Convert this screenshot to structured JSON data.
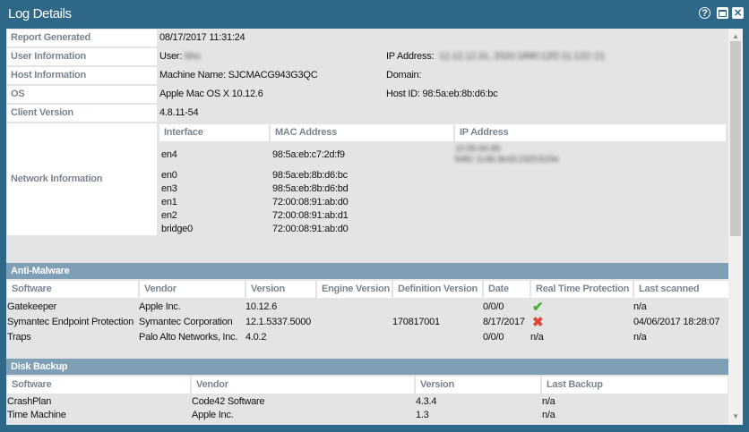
{
  "window": {
    "title": "Log Details",
    "help_icon": "help-icon",
    "maximize_icon": "maximize-icon",
    "close_icon": "close-icon"
  },
  "summary": {
    "report_generated": {
      "label": "Report Generated",
      "value": "08/17/2017 11:31:24"
    },
    "user_information": {
      "label": "User Information",
      "user_label": "User:",
      "user_value": "bhu",
      "ip_label": "IP Address:",
      "ip_value": "12.12.12.31, 2020:1890:12f2:11:122::21"
    },
    "host_information": {
      "label": "Host Information",
      "machine": "Machine Name: SJCMACG943G3QC",
      "domain": "Domain:"
    },
    "os": {
      "label": "OS",
      "value": "Apple Mac OS X 10.12.6",
      "host_id": "Host ID: 98:5a:eb:8b:d6:bc"
    },
    "client_version": {
      "label": "Client Version",
      "value": "4.8.11-54"
    }
  },
  "network": {
    "label": "Network Information",
    "columns": [
      "Interface",
      "MAC Address",
      "IP Address"
    ],
    "rows": [
      {
        "interface": "en4",
        "mac": "98:5a:eb:c7:2d:f9",
        "ip": [
          "10.55.84.89",
          "fe80::1c4b:3e43:2320:b15e"
        ]
      },
      {
        "interface": "en0",
        "mac": "98:5a:eb:8b:d6:bc",
        "ip": []
      },
      {
        "interface": "en3",
        "mac": "98:5a:eb:8b:d6:bd",
        "ip": []
      },
      {
        "interface": "en1",
        "mac": "72:00:08:91:ab:d0",
        "ip": []
      },
      {
        "interface": "en2",
        "mac": "72:00:08:91:ab:d1",
        "ip": []
      },
      {
        "interface": "bridge0",
        "mac": "72:00:08:91:ab:d0",
        "ip": []
      }
    ]
  },
  "anti_malware": {
    "title": "Anti-Malware",
    "columns": [
      "Software",
      "Vendor",
      "Version",
      "Engine Version",
      "Definition Version",
      "Date",
      "Real Time Protection",
      "Last scanned"
    ],
    "rows": [
      [
        "Gatekeeper",
        "Apple Inc.",
        "10.12.6",
        "",
        "",
        "0/0/0",
        "check-icon",
        "n/a"
      ],
      [
        "Symantec Endpoint Protection",
        "Symantec Corporation",
        "12.1.5337.5000",
        "",
        "170817001",
        "8/17/2017",
        "x-icon",
        "04/06/2017 18:28:07"
      ],
      [
        "Traps",
        "Palo Alto Networks, Inc.",
        "4.0.2",
        "",
        "",
        "0/0/0",
        "n/a",
        "n/a"
      ]
    ],
    "colors": {
      "check": "#4caf3a",
      "x": "#e0463a"
    }
  },
  "disk_backup": {
    "title": "Disk Backup",
    "columns": [
      "Software",
      "Vendor",
      "Version",
      "Last Backup"
    ],
    "rows": [
      [
        "CrashPlan",
        "Code42 Software",
        "4.3.4",
        "n/a"
      ],
      [
        "Time Machine",
        "Apple Inc.",
        "1.3",
        "n/a"
      ]
    ]
  },
  "colors": {
    "titlebar": "#2f6788",
    "section_header": "#7f9fb5",
    "label_text": "#7b8590"
  }
}
